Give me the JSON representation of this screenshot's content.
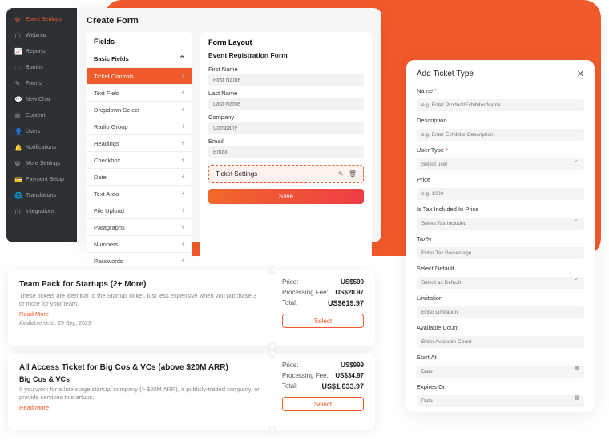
{
  "sidebar": {
    "items": [
      {
        "label": "Event Settings",
        "icon": "⚙"
      },
      {
        "label": "Webinar",
        "icon": "▢"
      },
      {
        "label": "Reports",
        "icon": "📈"
      },
      {
        "label": "Booths",
        "icon": "⬚"
      },
      {
        "label": "Forms",
        "icon": "✎"
      },
      {
        "label": "New Chat",
        "icon": "💬"
      },
      {
        "label": "Content",
        "icon": "▥"
      },
      {
        "label": "Users",
        "icon": "👤"
      },
      {
        "label": "Notifications",
        "icon": "🔔"
      },
      {
        "label": "More Settings",
        "icon": "⚙"
      },
      {
        "label": "Payment Setup",
        "icon": "💳"
      },
      {
        "label": "Translations",
        "icon": "🌐"
      },
      {
        "label": "Integrations",
        "icon": "◫"
      }
    ]
  },
  "create_form": {
    "title": "Create Form",
    "fields_header": "Fields",
    "basic_fields": "Basic Fields",
    "fields": [
      "Ticket Controls",
      "Text Field",
      "Dropdown Select",
      "Radio Group",
      "Headings",
      "Checkbox",
      "Date",
      "Text Area",
      "File Upload",
      "Paragraphs",
      "Numbers",
      "Passwords"
    ],
    "layout": {
      "header": "Form Layout",
      "form_title": "Event Registration Form",
      "first_name_label": "First Name",
      "first_name_ph": "First Name",
      "last_name_label": "Last Name",
      "last_name_ph": "Last Name",
      "company_label": "Company",
      "company_ph": "Company",
      "email_label": "Email",
      "email_ph": "Email",
      "ticket_settings": "Ticket Settings",
      "save": "Save"
    }
  },
  "tickets": [
    {
      "title": "Team Pack for Startups (2+ More)",
      "desc": "These tickets are identical to the Startup Ticket, just less expensive when you purchase 3 or more for your team.",
      "read_more": "Read More",
      "available": "Available Until: 29 Sep, 2023",
      "price_label": "Price:",
      "price": "US$599",
      "fee_label": "Processing Fee:",
      "fee": "US$20.97",
      "total_label": "Total:",
      "total": "US$619.97",
      "select": "Select"
    },
    {
      "title": "All Access Ticket for Big Cos & VCs (above $20M ARR)",
      "subtitle": "Big Cos & VCs",
      "desc": "If you work for a late-stage startup/ company (> $20M ARR), a publicly-traded company, or provide services to startups,",
      "read_more": "Read More",
      "price_label": "Price:",
      "price": "US$999",
      "fee_label": "Processing Fee:",
      "fee": "US$34.97",
      "total_label": "Total:",
      "total": "US$1,033.97",
      "select": "Select"
    }
  ],
  "add_ticket": {
    "title": "Add Ticket Type",
    "labels": {
      "name": "Name",
      "description": "Description",
      "user_type": "User Type",
      "price": "Price",
      "tax_included": "Is Tax Included In Price",
      "tax_pct": "Tax%",
      "select_default": "Select Default",
      "limitation": "Limitation",
      "available_count": "Available Count",
      "start_at": "Start At",
      "expires_on": "Expires On"
    },
    "placeholders": {
      "name": "e.g. Enter Product/Exhibitor Name",
      "description": "e.g. Enter Exhibitor Description",
      "user_type": "Select user",
      "price": "e.g. 1000",
      "tax_included": "Select Tax Included",
      "tax_pct": "Enter Tax Percentage",
      "select_default": "Select as Default",
      "limitation": "Enter Limitation",
      "available_count": "Enter Available Count",
      "start_at": "Date",
      "expires_on": "Date"
    }
  }
}
